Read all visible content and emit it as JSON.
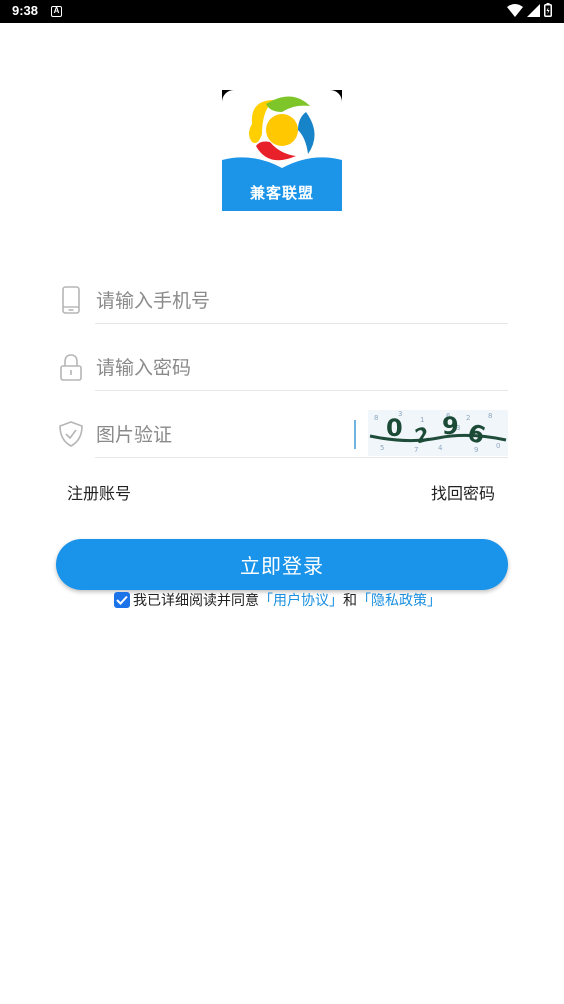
{
  "status_bar": {
    "time": "9:38",
    "notification_letter": "A",
    "icons": [
      "wifi-icon",
      "signal-icon",
      "battery-icon"
    ]
  },
  "logo": {
    "text": "兼客联盟",
    "colors": {
      "background": "#1c95e9",
      "yellow": "#ffcf00",
      "red": "#e8202a",
      "green": "#7ec52a",
      "blue": "#1783c8"
    }
  },
  "form": {
    "phone": {
      "placeholder": "请输入手机号",
      "value": "",
      "icon": "phone-icon"
    },
    "password": {
      "placeholder": "请输入密码",
      "value": "",
      "icon": "lock-icon"
    },
    "captcha": {
      "placeholder": "图片验证",
      "value": "",
      "icon": "shield-icon",
      "image_text": "0296"
    }
  },
  "links": {
    "register": "注册账号",
    "forgot_password": "找回密码"
  },
  "login_button": {
    "label": "立即登录",
    "color": "#1a94ea"
  },
  "agreement": {
    "checked": true,
    "prefix": "我已详细阅读并同意",
    "user_agreement": "「用户协议」",
    "conjunction": "和",
    "privacy_policy": "「隐私政策」",
    "link_color": "#1a8fe0"
  }
}
